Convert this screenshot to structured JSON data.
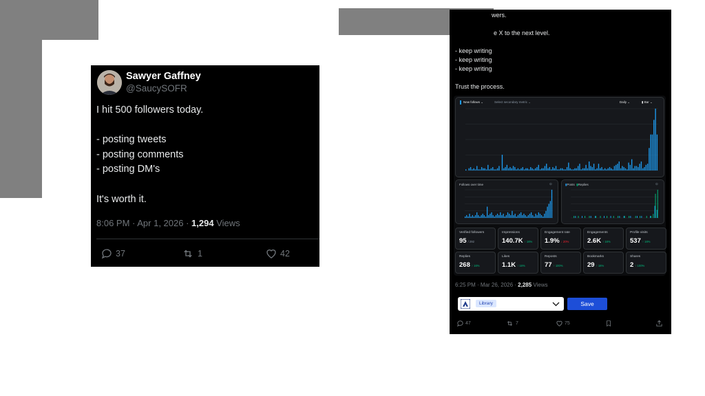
{
  "tweet_left": {
    "name": "Sawyer Gaffney",
    "handle": "@SaucySOFR",
    "lines": [
      "I hit 500 followers today.",
      "- posting tweets",
      "- posting comments",
      "- posting DM's",
      "It's worth it."
    ],
    "time": "8:06 PM · Apr 1, 2026 · ",
    "views_count": "1,294",
    "views_label": " Views",
    "replies": "37",
    "reposts": "1",
    "likes": "42"
  },
  "tweet_right": {
    "lines": [
      "wers.",
      "e X to the next level.",
      "- keep writing",
      "- keep writing",
      "- keep writing",
      "Trust the process."
    ],
    "analytics": {
      "metric_select": "New follows",
      "secondary_select": "Select secondary metric",
      "period_select": "Daily",
      "chart_type_select": "Bar",
      "follows_over_time_title": "Follows over time",
      "posts_legend": "Posts",
      "replies_legend": "Replies",
      "cards_row1": [
        {
          "label": "Verified followers",
          "value": "95",
          "sub": "/ 292"
        },
        {
          "label": "Impressions",
          "value": "140.7K",
          "change": "↑ 16%",
          "dir": "up"
        },
        {
          "label": "Engagement rate",
          "value": "1.9%",
          "change": "↓ 20%",
          "dir": "down"
        },
        {
          "label": "Engagements",
          "value": "2.6K",
          "change": "↑ 16%",
          "dir": "up"
        },
        {
          "label": "Profile visits",
          "value": "537",
          "change": "↑ 16%",
          "dir": "up"
        }
      ],
      "cards_row2": [
        {
          "label": "Replies",
          "value": "268",
          "change": "↑ 16%",
          "dir": "up"
        },
        {
          "label": "Likes",
          "value": "1.1K",
          "change": "↑ 16%",
          "dir": "up"
        },
        {
          "label": "Reposts",
          "value": "77",
          "change": "↑ 100%",
          "dir": "up"
        },
        {
          "label": "Bookmarks",
          "value": "29",
          "change": "↑ 16%",
          "dir": "up"
        },
        {
          "label": "Shares",
          "value": "2",
          "change": "↑ 100%",
          "dir": "up"
        }
      ]
    },
    "time": "6:25 PM · Mar 26, 2026 · ",
    "views_count": "2,285",
    "views_label": " Views",
    "library_tag": "Library",
    "save_label": "Save",
    "replies": "47",
    "reposts": "7",
    "likes": "75",
    "chart_data": [
      {
        "type": "bar",
        "title": "",
        "series": [
          {
            "name": "New follows",
            "values": [
              1,
              0,
              2,
              3,
              1,
              2,
              1,
              4,
              1,
              1,
              3,
              2,
              2,
              1,
              5,
              1,
              2,
              3,
              1,
              1,
              2,
              4,
              0,
              14,
              2,
              3,
              5,
              2,
              3,
              2,
              4,
              3,
              1,
              2,
              1,
              2,
              3,
              1,
              2,
              2,
              1,
              3,
              2,
              1,
              2,
              3,
              5,
              1,
              2,
              2,
              4,
              6,
              2,
              3,
              1,
              3,
              2,
              4,
              1,
              1,
              2,
              2,
              1,
              1,
              3,
              7,
              2,
              1,
              1,
              2,
              2,
              4,
              6,
              1,
              2,
              2,
              5,
              2,
              8,
              4,
              3,
              6,
              1,
              2,
              6,
              2,
              3,
              1,
              2,
              1,
              2,
              3,
              2,
              1,
              4,
              5,
              6,
              8,
              2,
              4,
              3,
              2,
              1,
              7,
              5,
              10,
              2,
              4,
              4,
              3,
              6,
              8,
              2,
              3,
              5,
              6,
              20,
              32,
              32,
              45,
              55,
              32
            ]
          }
        ]
      },
      {
        "type": "bar",
        "title": "Follows over time",
        "series": [
          {
            "name": "Follows over time",
            "values": [
              1,
              2,
              1,
              3,
              1,
              2,
              1,
              2,
              4,
              2,
              1,
              2,
              3,
              2,
              1,
              8,
              2,
              3,
              4,
              2,
              1,
              2,
              3,
              2,
              4,
              2,
              3,
              1,
              2,
              4,
              3,
              2,
              5,
              2,
              3,
              1,
              2,
              3,
              4,
              2,
              3,
              2,
              1,
              2,
              3,
              4,
              2,
              1,
              3,
              2,
              4,
              3,
              2,
              1,
              3,
              5,
              8,
              10,
              12,
              20
            ]
          }
        ]
      },
      {
        "type": "bar",
        "title": "",
        "series": [
          {
            "name": "Posts",
            "values": [
              0,
              0,
              1,
              0,
              0,
              1,
              0,
              0,
              0,
              1,
              0,
              1,
              0,
              0,
              0,
              1,
              0,
              0,
              1,
              0,
              0,
              0,
              1,
              0,
              1,
              0,
              0,
              1,
              0,
              0,
              1,
              0,
              1,
              0,
              0,
              0,
              1,
              0,
              6,
              4
            ]
          },
          {
            "name": "Replies",
            "values": [
              0,
              1,
              0,
              1,
              0,
              0,
              1,
              0,
              1,
              0,
              0,
              1,
              0,
              1,
              0,
              0,
              1,
              0,
              0,
              1,
              0,
              1,
              0,
              0,
              1,
              0,
              1,
              0,
              0,
              1,
              0,
              1,
              0,
              0,
              1,
              0,
              1,
              2,
              12,
              14
            ]
          }
        ]
      }
    ]
  },
  "colors": {
    "bar_blue": "#1d9bf0",
    "bar_green": "#00ba7c",
    "bar_red": "#f4212e",
    "save_blue": "#1d4ed8"
  }
}
